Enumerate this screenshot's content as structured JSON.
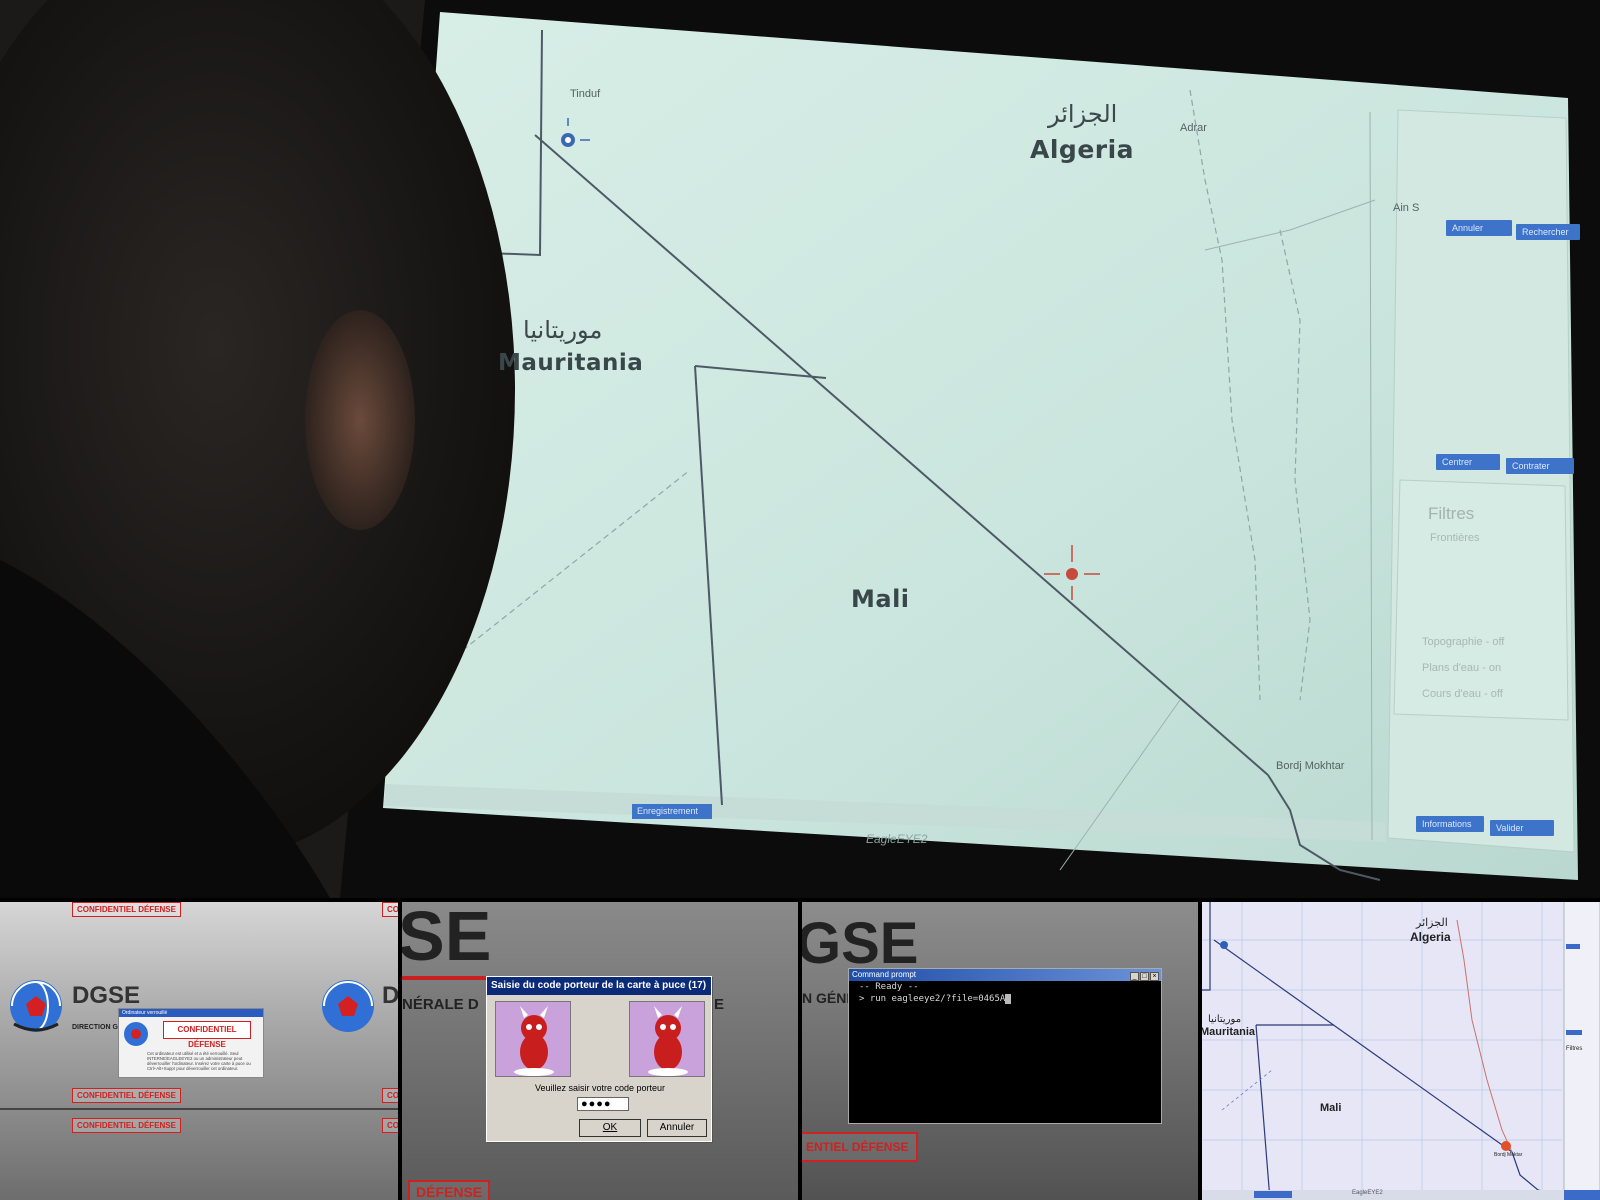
{
  "map": {
    "countries": {
      "algeria_ar": "الجزائر",
      "algeria_en": "Algeria",
      "mauritania_ar": "موريتانيا",
      "mauritania_en": "Mauritania",
      "mali_en": "Mali"
    },
    "towns": {
      "tindouf": "Tinduf",
      "adrar": "Adrar",
      "ain_salah": "Ain S",
      "bordj": "Bordj Mokhtar"
    },
    "panel": {
      "btn_1": "Annuler",
      "btn_2": "Rechercher",
      "btn_3": "Centrer",
      "btn_4": "Contrater",
      "filters_title": "Filtres",
      "frontieres": "Frontières",
      "topographie": "Topographie - off",
      "plans_eau": "Plans d'eau - on",
      "cours_eau": "Cours d'eau - off",
      "btn_5": "Informations",
      "btn_6": "Valider"
    },
    "taskbar": {
      "button": "Enregistrement",
      "app": "EagleEYE2"
    }
  },
  "dgse_screen": {
    "logo_text": "DGSE",
    "subtitle": "DIRECTION GÉNÉRALE",
    "badge": "CONFIDENTIEL DÉFENSE",
    "window_title": "Ordinateur verrouillé",
    "window_badge": "CONFIDENTIEL DÉFENSE",
    "window_msg": "Cet ordinateur est utilisé et a été verrouillé. Seul INTERNE\\EAGLEEYE2 ou un administrateur peut déverrouiller l'ordinateur. Insérez votre carte à puce ou Ctrl+Alt+Suppr pour déverrouiller cet ordinateur."
  },
  "card_dialog": {
    "background_text": "SE",
    "background_sub": "NÉRALE D",
    "background_sub_right": "E",
    "title": "Saisie du code porteur de la carte à puce (17)",
    "prompt": "Veuillez saisir votre code porteur",
    "pin_mask": "●●●●",
    "ok": "OK",
    "cancel": "Annuler",
    "bottom_badge": "DÉFENSE"
  },
  "cmd_window": {
    "background_text": "GSE",
    "background_sub": "N GÉNÉ",
    "title": "Command prompt",
    "line1": "-- Ready --",
    "line2": "> run eagleeye2/?file=0465A",
    "badge": "ENTIEL DÉFENSE"
  },
  "thumb_map": {
    "algeria_ar": "الجزائر",
    "algeria_en": "Algeria",
    "mauritania_ar": "موريتانيا",
    "mauritania_en": "Mauritania",
    "mali_en": "Mali",
    "bordj": "Bordj Moktar",
    "filters": "Filtres",
    "taskbar_app": "EagleEYE2"
  }
}
